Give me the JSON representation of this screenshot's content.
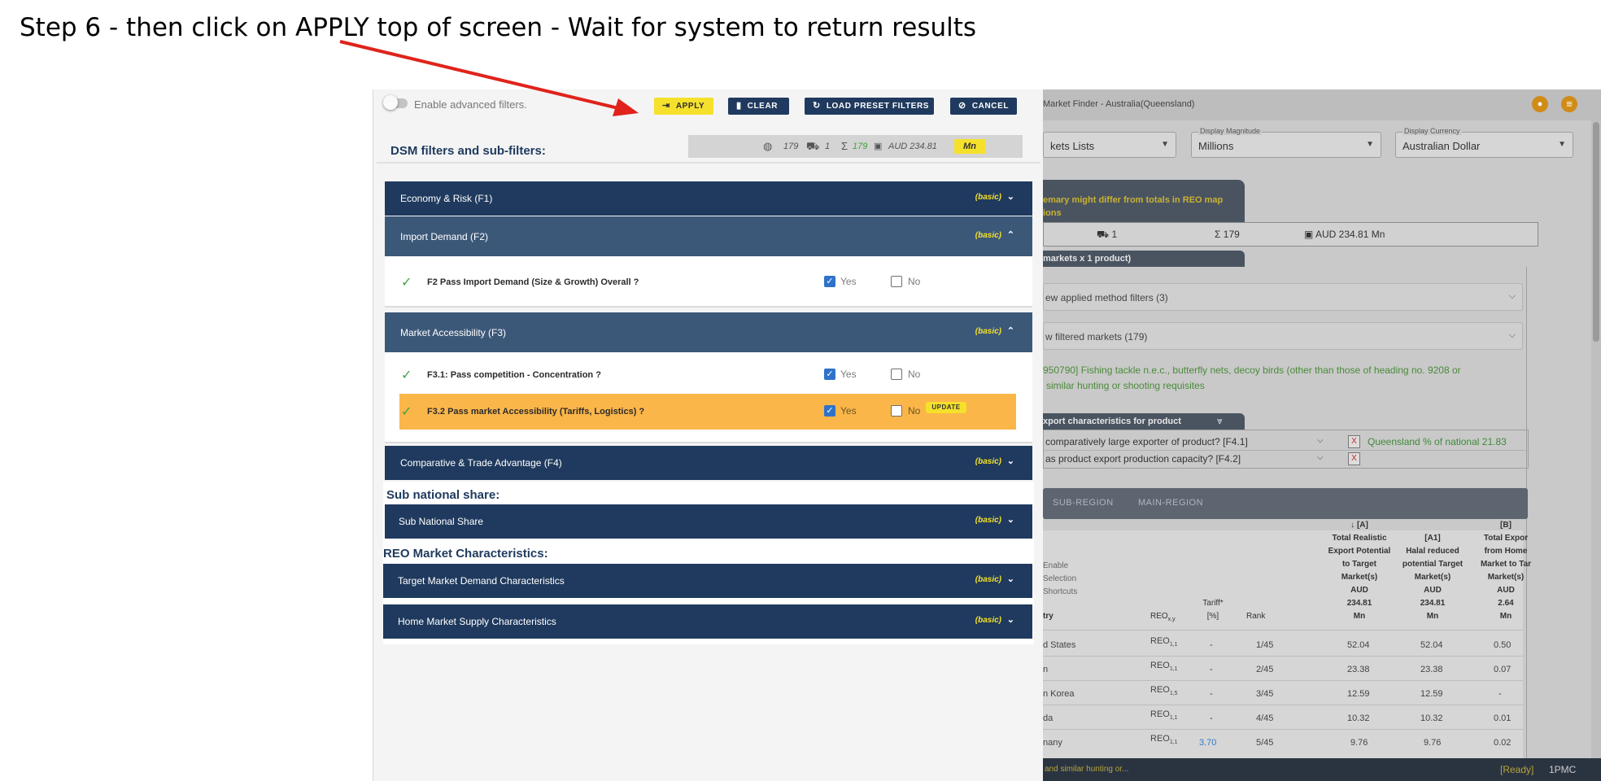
{
  "instruction": "Step 6 - then click on  APPLY top of screen - Wait for system to return results",
  "colors": {
    "navy": "#1f3a5e",
    "navy_open": "#3c5879",
    "accent_yellow": "#f5e12b",
    "update_orange": "#fbb64a",
    "check_green": "#43a047",
    "arrow_red": "#e0231b"
  },
  "filter_panel": {
    "toggle_label": "Enable advanced filters.",
    "buttons": {
      "apply": "APPLY",
      "clear": "CLEAR",
      "load_preset": "LOAD PRESET FILTERS",
      "cancel": "CANCEL"
    },
    "section_title": "DSM filters and sub-filters:",
    "summary": {
      "markets": "179",
      "products": "1",
      "total": "179",
      "value": "AUD 234.81",
      "magnitude": "Mn"
    },
    "accordions": {
      "f1": {
        "title": "Economy & Risk (F1)",
        "badge": "(basic)"
      },
      "f2": {
        "title": "Import Demand (F2)",
        "badge": "(basic)"
      },
      "f3": {
        "title": "Market Accessibility (F3)",
        "badge": "(basic)"
      },
      "f4": {
        "title": "Comparative & Trade Advantage (F4)",
        "badge": "(basic)"
      },
      "sub_national": {
        "title": "Sub National Share",
        "badge": "(basic)"
      },
      "target_market": {
        "title": "Target Market Demand Characteristics",
        "badge": "(basic)"
      },
      "home_market": {
        "title": "Home Market Supply Characteristics",
        "badge": "(basic)"
      }
    },
    "questions": {
      "f2": {
        "text": "F2 Pass Import Demand (Size & Growth) Overall ?",
        "yes": "Yes",
        "no": "No",
        "yes_checked": true
      },
      "f31": {
        "text": "F3.1: Pass competition - Concentration ?",
        "yes": "Yes",
        "no": "No",
        "yes_checked": true
      },
      "f32": {
        "text": "F3.2 Pass market Accessibility (Tariffs, Logistics) ?",
        "yes": "Yes",
        "no": "No",
        "yes_checked": true,
        "update": "UPDATE"
      }
    },
    "sub_national_title": "Sub national share:",
    "reo_title": "REO Market Characteristics:"
  },
  "background_app": {
    "title": "Market Finder - Australia(Queensland)",
    "selects": [
      {
        "label": "",
        "value": "kets Lists"
      },
      {
        "label": "Display Magnitude",
        "value": "Millions"
      },
      {
        "label": "Display Currency",
        "value": "Australian Dollar"
      }
    ],
    "warning": [
      "emary might differ from totals in REO map",
      "ions"
    ],
    "stats": {
      "products": "1",
      "total": "179",
      "value": "AUD 234.81 Mn"
    },
    "markets_tab": "markets x 1 product)",
    "accordions": [
      "ew applied method filters (3)",
      "w filtered markets (179)"
    ],
    "product": [
      "950790] Fishing tackle n.e.c., butterfly nets, decoy birds (other than those of heading no. 9208 or",
      "similar hunting or shooting requisites"
    ],
    "export_tab": "xport characteristics for product",
    "export_rows": [
      {
        "question": "comparatively large exporter of product? [F4.1]",
        "x": "X",
        "note": "Queensland % of national 21.83"
      },
      {
        "question": "as product export production capacity? [F4.2]",
        "x": "X",
        "note": ""
      }
    ],
    "region_tabs": [
      "SUB-REGION",
      "MAIN-REGION"
    ],
    "table": {
      "side_labels": [
        "Enable",
        "Selection",
        "Shortcuts"
      ],
      "headers": {
        "country": "try",
        "reo": "REO",
        "reo_sub": "x,y",
        "tariff": [
          "Tariff*",
          "[%]"
        ],
        "rank": "Rank",
        "a": [
          "[A]",
          "Total Realistic",
          "Export Potential",
          "to Target",
          "Market(s)",
          "AUD",
          "234.81",
          "Mn"
        ],
        "a1": [
          "[A1]",
          "Halal reduced",
          "potential Target",
          "Market(s)",
          "AUD",
          "234.81",
          "Mn"
        ],
        "b": [
          "[B]",
          "Total Expor",
          "from Home",
          "Market to Tar",
          "Market(s)",
          "AUD",
          "2.64",
          "Mn"
        ]
      },
      "rows": [
        {
          "country": "d States",
          "reo": "REO",
          "reo_sub": "1,1",
          "tariff": "-",
          "rank": "1/45",
          "a": "52.04",
          "a1": "52.04",
          "b": "0.50"
        },
        {
          "country": "n",
          "reo": "REO",
          "reo_sub": "1,1",
          "tariff": "-",
          "rank": "2/45",
          "a": "23.38",
          "a1": "23.38",
          "b": "0.07"
        },
        {
          "country": "n Korea",
          "reo": "REO",
          "reo_sub": "1,5",
          "tariff": "-",
          "rank": "3/45",
          "a": "12.59",
          "a1": "12.59",
          "b": "-"
        },
        {
          "country": "da",
          "reo": "REO",
          "reo_sub": "1,1",
          "tariff": "-",
          "rank": "4/45",
          "a": "10.32",
          "a1": "10.32",
          "b": "0.01"
        },
        {
          "country": "nany",
          "reo": "REO",
          "reo_sub": "1,1",
          "tariff": "3.70",
          "rank": "5/45",
          "a": "9.76",
          "a1": "9.76",
          "b": "0.02"
        }
      ]
    },
    "footer": {
      "left": "and similar hunting or...",
      "status": "[Ready]",
      "code": "1PMC"
    }
  }
}
